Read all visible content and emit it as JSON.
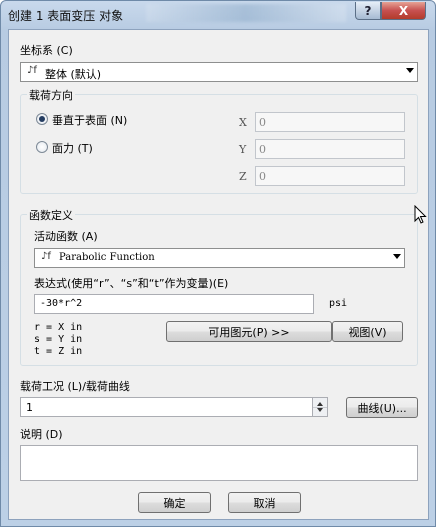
{
  "window": {
    "title": "创建 1 表面变压 对象",
    "help_label": "?",
    "close_label": "X"
  },
  "coord": {
    "label": "坐标系 (C)",
    "selected": "整体 (默认)",
    "icon_text": "♪f"
  },
  "load_direction": {
    "group_label": "载荷方向",
    "options": [
      {
        "label": "垂直于表面 (N)",
        "selected": true
      },
      {
        "label": "面力 (T)",
        "selected": false
      }
    ],
    "axes": [
      {
        "label": "X",
        "value": "0"
      },
      {
        "label": "Y",
        "value": "0"
      },
      {
        "label": "Z",
        "value": "0"
      }
    ]
  },
  "function_def": {
    "group_label": "函数定义",
    "active_label": "活动函数 (A)",
    "active_value": "Parabolic Function",
    "icon_text": "♪f",
    "expr_label": "表达式(使用“r”、“s”和“t”作为变量)(E)",
    "expr_value": "-30*r^2",
    "unit": "psi",
    "vars": [
      "r = X in",
      "s = Y in",
      "t = Z in"
    ],
    "primitives_button": "可用图元(P) >>",
    "view_button": "视图(V)"
  },
  "load_case": {
    "label": "载荷工况 (L)/载荷曲线",
    "value": "1",
    "curve_button": "曲线(U)..."
  },
  "description": {
    "label": "说明 (D)",
    "value": ""
  },
  "footer": {
    "ok": "确定",
    "cancel": "取消"
  }
}
